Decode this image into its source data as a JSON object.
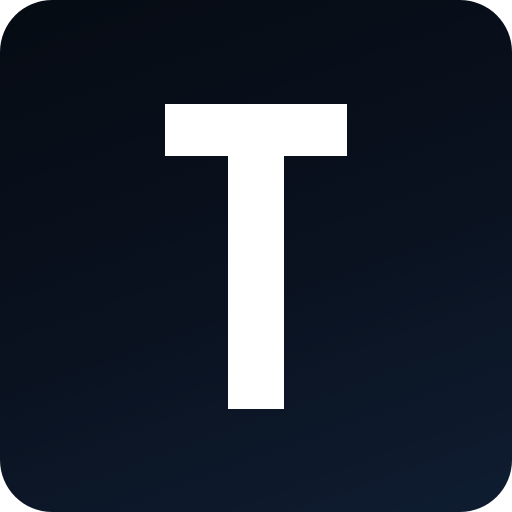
{
  "app_icon": {
    "letter": "T",
    "background_color_top": "#060b13",
    "background_color_bottom": "#0f1d31",
    "glyph_color": "#ffffff"
  }
}
